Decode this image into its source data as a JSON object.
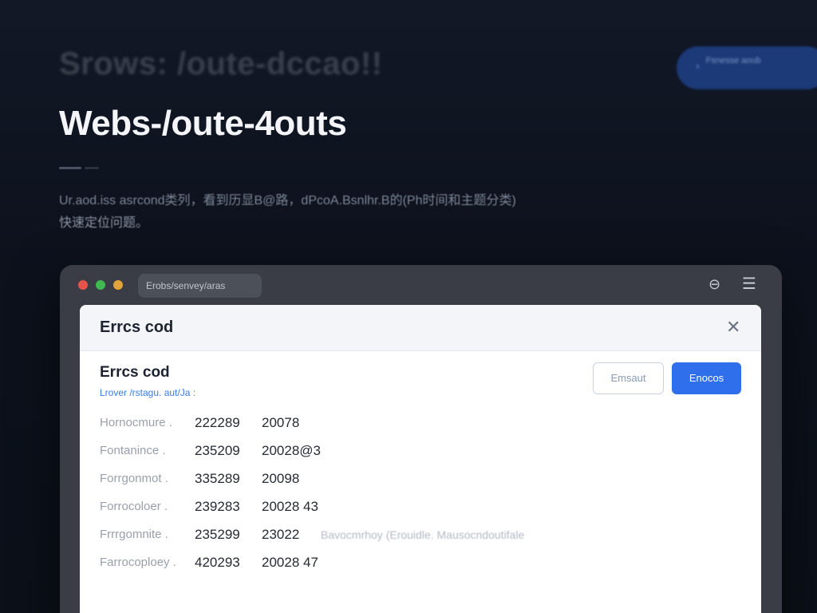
{
  "hero": {
    "eyebrow": "Srows: /oute-dccao!!",
    "cta_text": "Fsnesse aoub",
    "title": "Webs-/oute-4outs",
    "description_line1": "Ur.aod.iss asrcond类列，看到历显B@路，dPcoA.Bsnlhr.B的(Ph时间和主题分类)",
    "description_line2": "快速定位问题。"
  },
  "window": {
    "url": "Erobs/senvey/aras"
  },
  "dialog": {
    "title": "Errcs cod",
    "section_title": "Errcs cod",
    "section_path": "Lrover /rstagu. aut/Ja :",
    "secondary_button": "Emsaut",
    "primary_button": "Enocos",
    "rows": [
      {
        "name": "Hornocmure .",
        "code": "222289",
        "value": "20078",
        "note": ""
      },
      {
        "name": "Fontanince .",
        "code": "235209",
        "value": "20028@3",
        "note": ""
      },
      {
        "name": "Forrgonmot .",
        "code": "335289",
        "value": "20098",
        "note": ""
      },
      {
        "name": "Forrocoloer .",
        "code": "239283",
        "value": "20028 43",
        "note": ""
      },
      {
        "name": "Frrrgomnite .",
        "code": "235299",
        "value": "23022",
        "note": "Bavocmrhoy (Erouidle. Mausocndoutifale"
      },
      {
        "name": "Farrocoploey .",
        "code": "420293",
        "value": "20028 47",
        "note": ""
      }
    ]
  },
  "colors": {
    "primary": "#2f6fec",
    "background": "#0c111c",
    "window": "#3a3d45"
  }
}
